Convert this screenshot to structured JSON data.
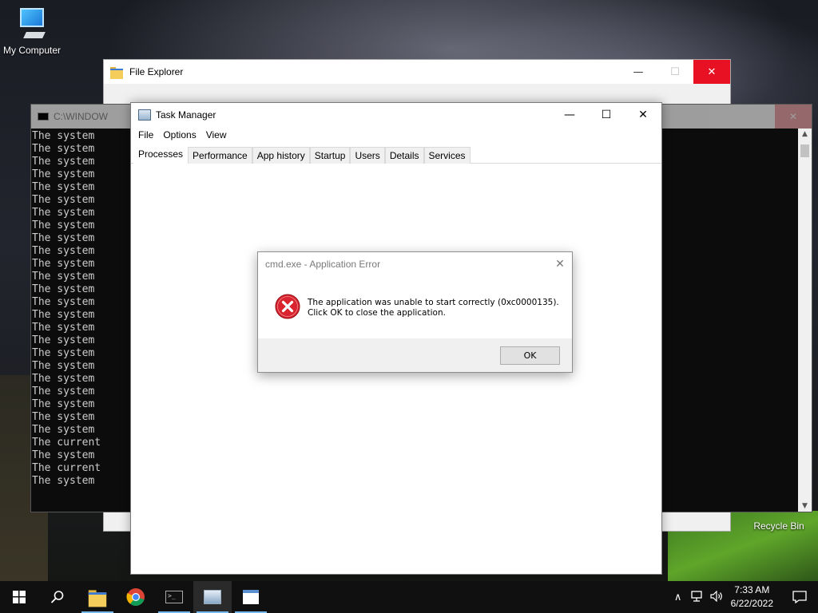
{
  "desktop": {
    "icons": [
      {
        "label": "My Computer",
        "icon": "computer-icon"
      },
      {
        "label": "Recycle Bin",
        "icon": "recycle-bin-icon"
      }
    ]
  },
  "file_explorer": {
    "title": "File Explorer",
    "controls": {
      "minimize": "—",
      "maximize": "☐",
      "close": "✕"
    }
  },
  "console": {
    "title": "C:\\WINDOW",
    "lines": [
      "The system",
      "The system",
      "The system",
      "The system",
      "The system",
      "The system",
      "The system",
      "The system",
      "The system",
      "The system",
      "The system",
      "The system",
      "The system",
      "The system",
      "The system",
      "The system",
      "The system",
      "The system",
      "The system",
      "The system",
      "The system",
      "The system",
      "The system",
      "The system",
      "The current",
      "The system",
      "The current",
      "The system"
    ]
  },
  "task_manager": {
    "title": "Task Manager",
    "controls": {
      "minimize": "—",
      "maximize": "☐",
      "close": "✕"
    },
    "menu": [
      "File",
      "Options",
      "View"
    ],
    "tabs": [
      "Processes",
      "Performance",
      "App history",
      "Startup",
      "Users",
      "Details",
      "Services"
    ],
    "active_tab": "Processes"
  },
  "error_dialog": {
    "title": "cmd.exe - Application Error",
    "close": "✕",
    "message_line1": "The application was unable to start correctly (0xc0000135).",
    "message_line2": "Click OK to close the application.",
    "ok_label": "OK",
    "icon": "error-icon"
  },
  "taskbar": {
    "items": [
      "start-icon",
      "search-icon",
      "file-explorer-icon",
      "chrome-icon",
      "cmd-icon",
      "task-manager-icon",
      "notepad-icon"
    ],
    "tray": {
      "chevron": "∧",
      "time": "7:33 AM",
      "date": "6/22/2022"
    }
  },
  "colors": {
    "close_red": "#e81123",
    "error_red": "#d9232e",
    "taskbar_bg": "#101010",
    "accent": "#76b9ed"
  }
}
